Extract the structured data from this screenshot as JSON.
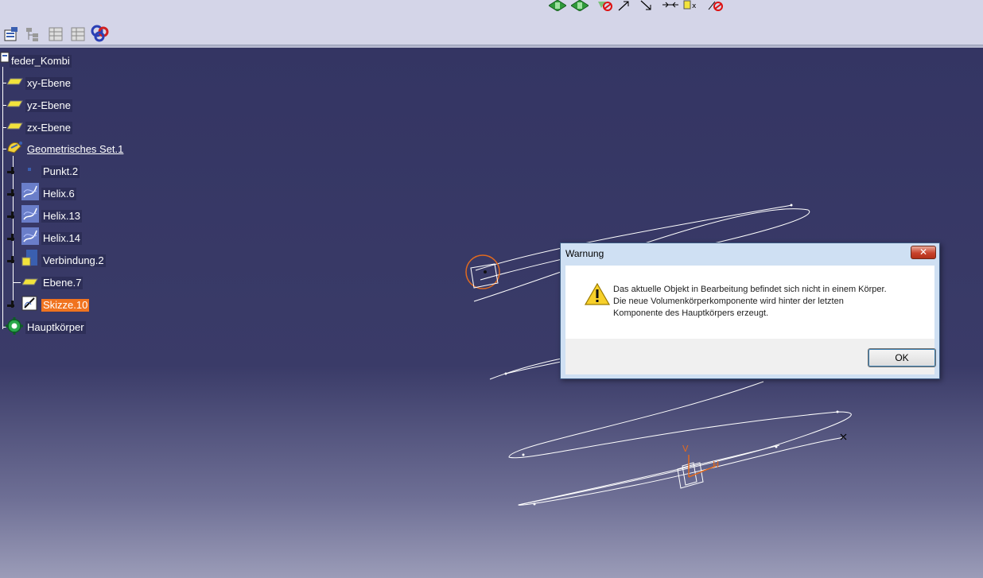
{
  "colors": {
    "viewport_top": "#343563",
    "viewport_bottom": "#9b9cb8",
    "selection": "#f0731f",
    "toolbar_bg": "#d4d5e8",
    "dialog_frame": "#cfe0f3"
  },
  "toolbar": {
    "top_icons": [
      "green-arrows-icon",
      "green-arrows-icon",
      "no-entry-icon",
      "arrow-up-right-icon",
      "arrow-down-right-icon",
      "constraint-icon",
      "yellow-dimension-icon",
      "no-entry-icon"
    ],
    "left_icons": [
      "properties-icon",
      "tree-icon",
      "table-icon",
      "table-icon",
      "colored-wheel-icon"
    ]
  },
  "tree": {
    "root": "feder_Kombi",
    "items": [
      {
        "label": "xy-Ebene",
        "icon": "plane-icon"
      },
      {
        "label": "yz-Ebene",
        "icon": "plane-icon"
      },
      {
        "label": "zx-Ebene",
        "icon": "plane-icon"
      },
      {
        "label": "Geometrisches Set.1",
        "icon": "geometrical-set-icon"
      },
      {
        "label": "Punkt.2",
        "icon": "point-icon"
      },
      {
        "label": "Helix.6",
        "icon": "helix-icon"
      },
      {
        "label": "Helix.13",
        "icon": "helix-icon"
      },
      {
        "label": "Helix.14",
        "icon": "helix-icon"
      },
      {
        "label": "Verbindung.2",
        "icon": "join-icon"
      },
      {
        "label": "Ebene.7",
        "icon": "plane-icon"
      },
      {
        "label": "Skizze.10",
        "icon": "sketch-icon"
      },
      {
        "label": "Hauptkörper",
        "icon": "gear-icon"
      }
    ]
  },
  "dialog": {
    "title": "Warnung",
    "close_label": "✕",
    "message_line1": "Das aktuelle Objekt in Bearbeitung befindet sich nicht in einem Körper.",
    "message_line2": "Die neue Volumenkörperkomponente wird hinter der letzten",
    "message_line3": "Komponente des Hauptkörpers erzeugt.",
    "ok_label": "OK"
  },
  "axis_labels": {
    "v": "V",
    "h": "H"
  }
}
